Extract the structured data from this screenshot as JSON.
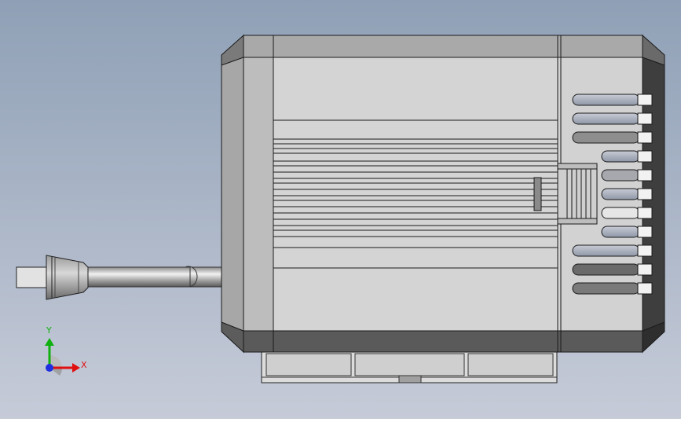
{
  "colors": {
    "background_top": "#8fa0b6",
    "background_bottom": "#c6cbd8",
    "body_light": "#d4d4d4",
    "body_mid": "#a9a9a9",
    "body_dark": "#5a5a5a",
    "body_darkest": "#3e3e3e",
    "edge": "#1a1a1a",
    "axis_x": "#e01010",
    "axis_y": "#10b010",
    "axis_z": "#2030e0"
  },
  "triad": {
    "x_label": "X",
    "y_label": "Y",
    "icon": "coordinate-triad-icon"
  }
}
